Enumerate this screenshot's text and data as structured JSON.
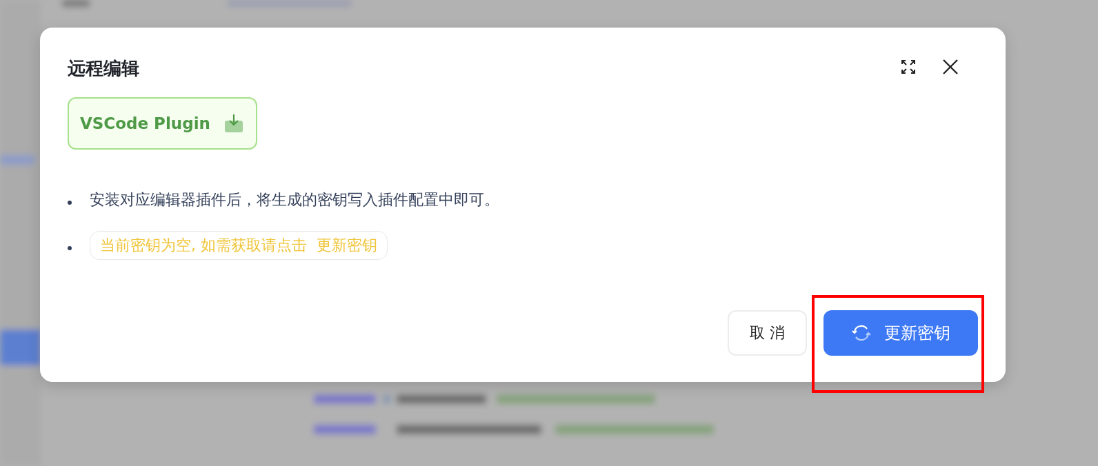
{
  "dialog": {
    "title": "远程编辑",
    "plugin_button": {
      "label": "VSCode Plugin"
    },
    "notes": [
      {
        "kind": "text",
        "text": "安装对应编辑器插件后，将生成的密钥写入插件配置中即可。"
      },
      {
        "kind": "warning",
        "text": "当前密钥为空, 如需获取请点击  更新密钥"
      }
    ],
    "buttons": [
      {
        "kind": "secondary",
        "label": "取 消"
      },
      {
        "kind": "primary",
        "label": "更新密钥",
        "highlighted": true
      }
    ]
  }
}
